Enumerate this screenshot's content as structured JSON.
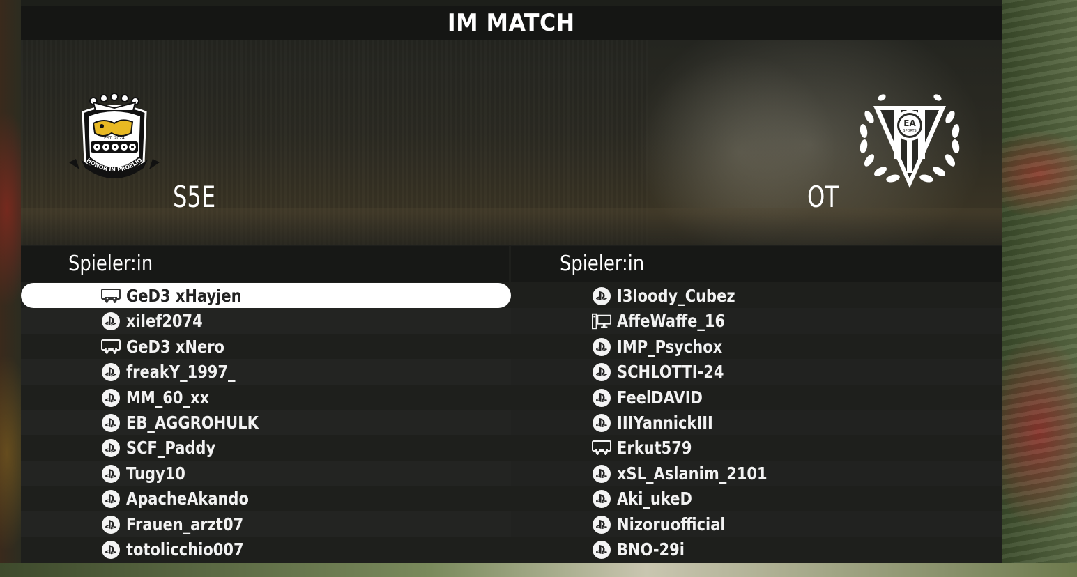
{
  "title": "IM MATCH",
  "home": {
    "name": "S5E",
    "crest_text": [
      "EST. 2024",
      "HONOR IN PROELIO"
    ],
    "crest_icon": "lion-crown-crest-icon"
  },
  "away": {
    "name": "OT",
    "crest_text": [
      "EA",
      "SPORTS"
    ],
    "crest_icon": "laurel-shield-crest-icon"
  },
  "columns": {
    "left_header": "Spieler:in",
    "right_header": "Spieler:in"
  },
  "players_left": [
    {
      "name": "GeD3 xHayjen",
      "platform": "controller-icon",
      "selected": true
    },
    {
      "name": "xilef2074",
      "platform": "playstation-icon"
    },
    {
      "name": "GeD3 xNero",
      "platform": "controller-icon"
    },
    {
      "name": "freakY_1997_",
      "platform": "playstation-icon"
    },
    {
      "name": "MM_60_xx",
      "platform": "playstation-icon"
    },
    {
      "name": "EB_AGGROHULK",
      "platform": "playstation-icon"
    },
    {
      "name": "SCF_Paddy",
      "platform": "playstation-icon"
    },
    {
      "name": "Tugy10",
      "platform": "playstation-icon"
    },
    {
      "name": "ApacheAkando",
      "platform": "playstation-icon"
    },
    {
      "name": "Frauen_arzt07",
      "platform": "playstation-icon"
    },
    {
      "name": "totolicchio007",
      "platform": "playstation-icon"
    }
  ],
  "players_right": [
    {
      "name": "I3loody_Cubez",
      "platform": "playstation-icon"
    },
    {
      "name": "AffeWaffe_16",
      "platform": "pc-icon"
    },
    {
      "name": "IMP_Psychox",
      "platform": "playstation-icon"
    },
    {
      "name": "SCHLOTTI-24",
      "platform": "playstation-icon"
    },
    {
      "name": "FeelDAVID",
      "platform": "playstation-icon"
    },
    {
      "name": "IIIYannickIII",
      "platform": "playstation-icon"
    },
    {
      "name": "Erkut579",
      "platform": "controller-icon"
    },
    {
      "name": "xSL_Aslanim_2101",
      "platform": "playstation-icon"
    },
    {
      "name": "Aki_ukeD",
      "platform": "playstation-icon"
    },
    {
      "name": "Nizoruofficial",
      "platform": "playstation-icon"
    },
    {
      "name": "BNO-29i",
      "platform": "playstation-icon"
    }
  ],
  "colors": {
    "panel": "#1e1f1c",
    "selected_row": "#ffffff",
    "home_crest_gold": "#e8b923"
  }
}
